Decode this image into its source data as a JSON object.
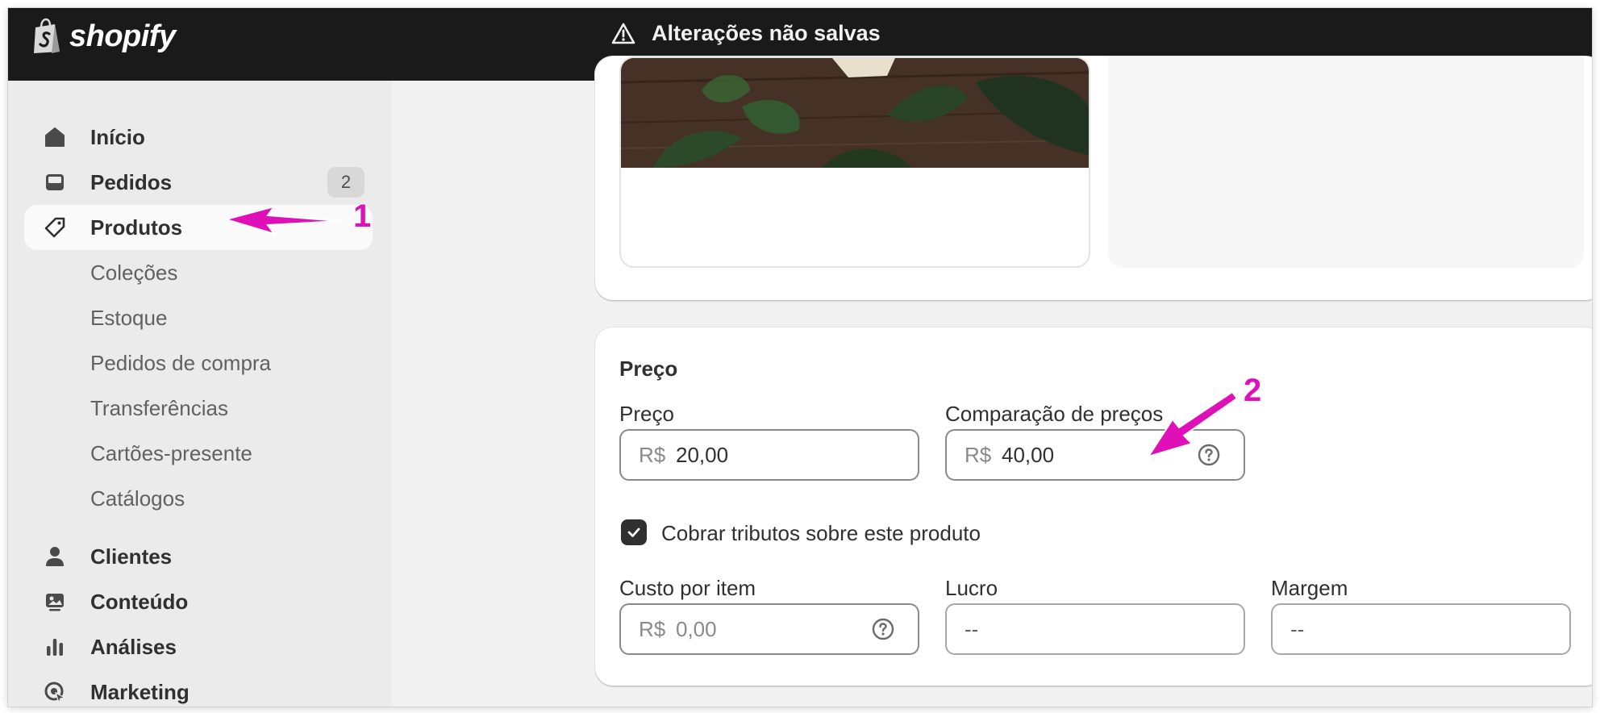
{
  "topbar": {
    "logo_text": "shopify",
    "notice": "Alterações não salvas"
  },
  "sidebar": {
    "items": [
      {
        "label": "Início",
        "icon": "home-icon"
      },
      {
        "label": "Pedidos",
        "icon": "inbox-icon",
        "badge": "2"
      },
      {
        "label": "Produtos",
        "icon": "tag-icon",
        "active": true
      },
      {
        "label": "Coleções"
      },
      {
        "label": "Estoque"
      },
      {
        "label": "Pedidos de compra"
      },
      {
        "label": "Transferências"
      },
      {
        "label": "Cartões-presente"
      },
      {
        "label": "Catálogos"
      },
      {
        "label": "Clientes",
        "icon": "person-icon"
      },
      {
        "label": "Conteúdo",
        "icon": "image-icon"
      },
      {
        "label": "Análises",
        "icon": "bar-chart-icon"
      },
      {
        "label": "Marketing",
        "icon": "target-icon"
      }
    ]
  },
  "pricing": {
    "title": "Preço",
    "price": {
      "label": "Preço",
      "prefix": "R$",
      "value": "20,00"
    },
    "compare_at": {
      "label": "Comparação de preços",
      "prefix": "R$",
      "value": "40,00"
    },
    "charge_tax": {
      "label": "Cobrar tributos sobre este produto",
      "checked": true
    },
    "cost": {
      "label": "Custo por item",
      "prefix": "R$",
      "placeholder": "0,00"
    },
    "profit": {
      "label": "Lucro",
      "value": "--"
    },
    "margin": {
      "label": "Margem",
      "value": "--"
    }
  },
  "annotations": {
    "one": "1",
    "two": "2",
    "color": "#e010b8"
  },
  "colors": {
    "topbar": "#1a1a1a",
    "sidebar": "#ebebeb",
    "page": "#f1f1f1",
    "card": "#ffffff"
  }
}
